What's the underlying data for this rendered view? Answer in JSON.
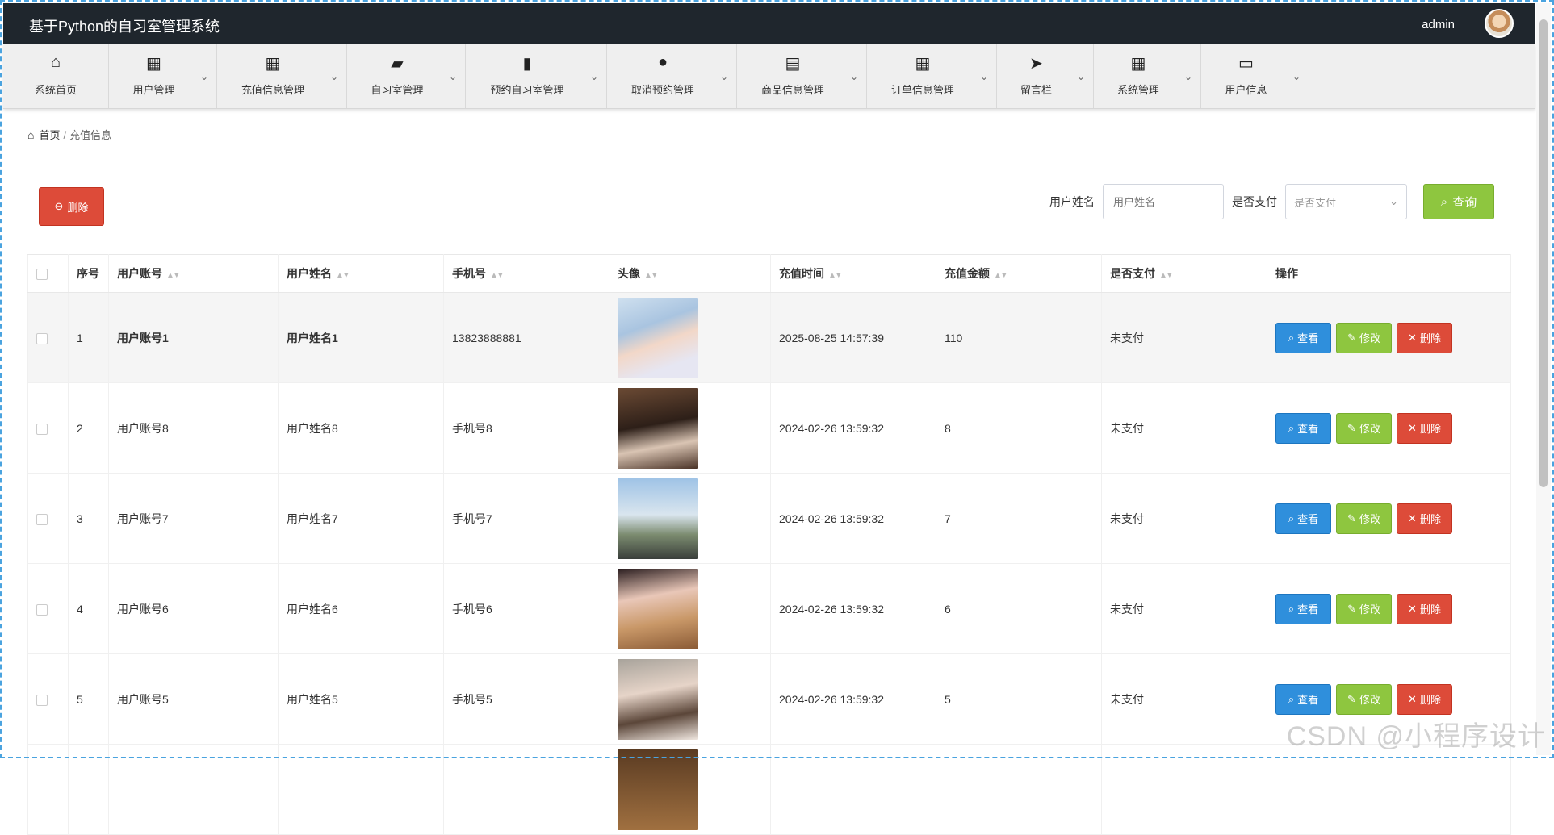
{
  "app": {
    "title": "基于Python的自习室管理系统",
    "user": "admin"
  },
  "nav": [
    {
      "label": "系统首页",
      "icon": "home-icon",
      "glyph": "⌂",
      "caret": false
    },
    {
      "label": "用户管理",
      "icon": "grid-icon",
      "glyph": "▦",
      "caret": true
    },
    {
      "label": "充值信息管理",
      "icon": "grid-icon",
      "glyph": "▦",
      "caret": true
    },
    {
      "label": "自习室管理",
      "icon": "presentation-icon",
      "glyph": "▰",
      "caret": true
    },
    {
      "label": "预约自习室管理",
      "icon": "bar-chart-icon",
      "glyph": "▮",
      "caret": true
    },
    {
      "label": "取消预约管理",
      "icon": "user-icon",
      "glyph": "●",
      "caret": true
    },
    {
      "label": "商品信息管理",
      "icon": "clipboard-icon",
      "glyph": "▤",
      "caret": true
    },
    {
      "label": "订单信息管理",
      "icon": "grid-icon",
      "glyph": "▦",
      "caret": true
    },
    {
      "label": "留言栏",
      "icon": "paper-plane-icon",
      "glyph": "➤",
      "caret": true
    },
    {
      "label": "系统管理",
      "icon": "grid-icon",
      "glyph": "▦",
      "caret": true
    },
    {
      "label": "用户信息",
      "icon": "wallet-icon",
      "glyph": "▭",
      "caret": true
    }
  ],
  "breadcrumb": {
    "home": "首页",
    "separator": "/",
    "current": "充值信息"
  },
  "toolbar": {
    "delete_label": "删除",
    "name_label": "用户姓名",
    "name_placeholder": "用户姓名",
    "paid_label": "是否支付",
    "paid_placeholder": "是否支付",
    "query_label": "查询"
  },
  "table": {
    "headers": {
      "index": "序号",
      "account": "用户账号",
      "name": "用户姓名",
      "phone": "手机号",
      "avatar": "头像",
      "time": "充值时间",
      "amount": "充值金额",
      "paid": "是否支付",
      "ops": "操作"
    },
    "rows": [
      {
        "index": "1",
        "account": "用户账号1",
        "name": "用户姓名1",
        "phone": "13823888881",
        "time": "2025-08-25 14:57:39",
        "amount": "110",
        "paid": "未支付"
      },
      {
        "index": "2",
        "account": "用户账号8",
        "name": "用户姓名8",
        "phone": "手机号8",
        "time": "2024-02-26 13:59:32",
        "amount": "8",
        "paid": "未支付"
      },
      {
        "index": "3",
        "account": "用户账号7",
        "name": "用户姓名7",
        "phone": "手机号7",
        "time": "2024-02-26 13:59:32",
        "amount": "7",
        "paid": "未支付"
      },
      {
        "index": "4",
        "account": "用户账号6",
        "name": "用户姓名6",
        "phone": "手机号6",
        "time": "2024-02-26 13:59:32",
        "amount": "6",
        "paid": "未支付"
      },
      {
        "index": "5",
        "account": "用户账号5",
        "name": "用户姓名5",
        "phone": "手机号5",
        "time": "2024-02-26 13:59:32",
        "amount": "5",
        "paid": "未支付"
      }
    ],
    "actions": {
      "view": "查看",
      "edit": "修改",
      "delete": "删除"
    }
  },
  "watermark": "CSDN @小程序设计"
}
